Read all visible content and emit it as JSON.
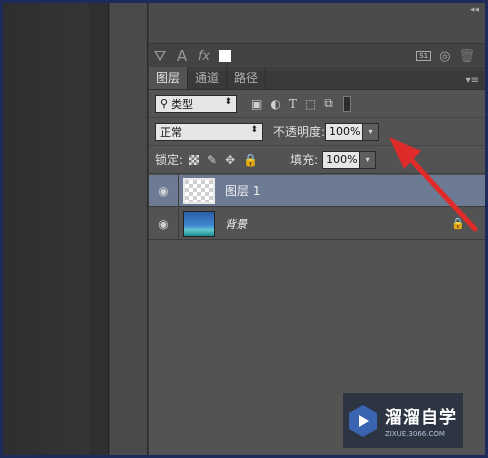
{
  "colors": {
    "arrow": "#e02b2b",
    "selected_row": "#6c7b93",
    "frame_border": "#1e2a5a"
  },
  "toolbar": {
    "icons": [
      "path-select-icon",
      "type-icon",
      "fx-icon",
      "color-swatch-icon"
    ],
    "text_glyph": "A",
    "fx_glyph": "fx",
    "right_icons": [
      "s1-icon",
      "visibility-icon",
      "trash-icon"
    ],
    "s1_label": "S1"
  },
  "tabs": [
    {
      "label": "图层",
      "active": true
    },
    {
      "label": "通道",
      "active": false
    },
    {
      "label": "路径",
      "active": false
    }
  ],
  "filter": {
    "label": "类型"
  },
  "blend": {
    "mode": "正常",
    "opacity_label": "不透明度:",
    "opacity_value": "100%"
  },
  "lock": {
    "label": "锁定:",
    "fill_label": "填充:",
    "fill_value": "100%"
  },
  "layers": [
    {
      "name": "图层 1",
      "selected": true,
      "thumbnail": "transparent"
    },
    {
      "name": "背景",
      "selected": false,
      "thumbnail": "sea",
      "locked": true
    }
  ],
  "watermark": {
    "title": "溜溜自学",
    "url": "ZIXUE.3066.COM"
  }
}
